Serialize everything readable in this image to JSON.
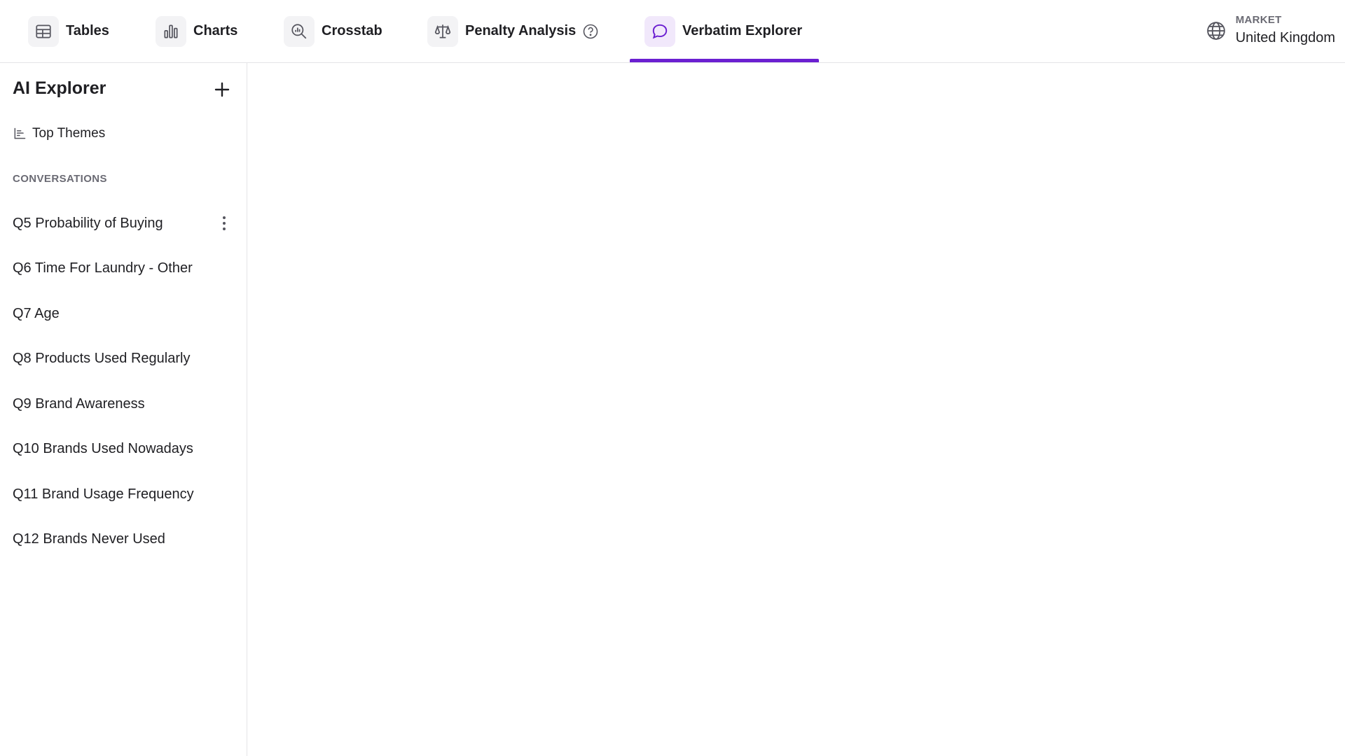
{
  "nav": {
    "tabs": [
      {
        "label": "Tables",
        "icon": "table-icon"
      },
      {
        "label": "Charts",
        "icon": "bar-chart-icon"
      },
      {
        "label": "Crosstab",
        "icon": "magnify-chart-icon"
      },
      {
        "label": "Penalty Analysis",
        "icon": "scale-icon",
        "help_icon": "help-circle-icon"
      },
      {
        "label": "Verbatim Explorer",
        "icon": "chat-bubble-icon",
        "active": true
      }
    ],
    "active_tab": "Verbatim Explorer",
    "market": {
      "caption": "MARKET",
      "value": "United Kingdom",
      "icon": "globe-icon"
    }
  },
  "sidebar": {
    "title": "AI Explorer",
    "new_icon": "plus-icon",
    "top_themes": {
      "label": "Top Themes",
      "icon": "list-chart-icon"
    },
    "section_header": "CONVERSATIONS",
    "conversations": [
      {
        "label": "Q5 Probability of Buying",
        "has_menu": true
      },
      {
        "label": "Q6 Time For Laundry - Other"
      },
      {
        "label": "Q7 Age"
      },
      {
        "label": "Q8 Products Used Regularly"
      },
      {
        "label": "Q9 Brand Awareness"
      },
      {
        "label": "Q10 Brands Used Nowadays"
      },
      {
        "label": "Q11 Brand Usage Frequency"
      },
      {
        "label": "Q12 Brands Never Used"
      }
    ]
  },
  "colors": {
    "accent": "#6b1fd1",
    "active_icon_bg": "#f1e8fb",
    "icon_bg": "#f3f3f5",
    "border": "#e4e4e7",
    "muted_text": "#6b6b74"
  }
}
